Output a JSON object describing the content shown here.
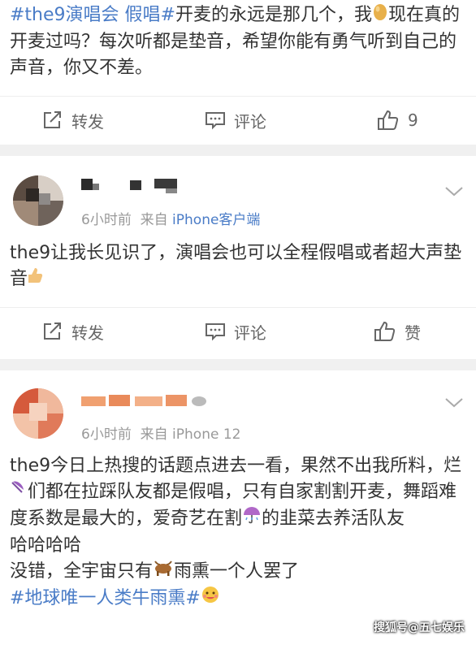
{
  "post1": {
    "hashtag": "#the9演唱会 假唱#",
    "text_a": "开麦的永远是那几个，我",
    "text_b": "现在真的开麦过吗？每次听都是垫音，希望你能有勇气听到自己的声音，你又不差。",
    "actions": {
      "repost": "转发",
      "comment": "评论",
      "like_count": "9"
    }
  },
  "comment1": {
    "time": "6小时前",
    "from": "来自",
    "source": "iPhone客户端",
    "text": "the9让我长见识了，演唱会也可以全程假唱或者超大声垫音",
    "actions": {
      "repost": "转发",
      "comment": "评论",
      "like": "赞"
    }
  },
  "comment2": {
    "time": "6小时前",
    "from": "来自",
    "source": "iPhone 12",
    "line1": "the9今日上热搜的话题点进去一看，果然不出我所料，烂",
    "line1b": "们都在拉踩队友都是假唱，只有自家割割开麦，舞蹈难度系数是最大的，爱奇艺在割",
    "line1c": "的韭菜去养活队友",
    "line2": "哈哈哈哈",
    "line3a": "没错，全宇宙只有",
    "line3b": "雨熏一个人罢了",
    "hashtag": "#地球唯一人类牛雨熏#"
  },
  "watermark": "搜狐号@五七娱乐",
  "icons": [
    "repost-icon",
    "comment-icon",
    "like-icon",
    "chevron-down-icon",
    "egg-emoji",
    "umbrella-emoji",
    "ox-emoji",
    "thumbs-up-emoji",
    "grin-emoji"
  ],
  "colors": {
    "link": "#4a7cc7",
    "text": "#333333",
    "muted": "#999999",
    "divider": "#f0f0f0"
  }
}
